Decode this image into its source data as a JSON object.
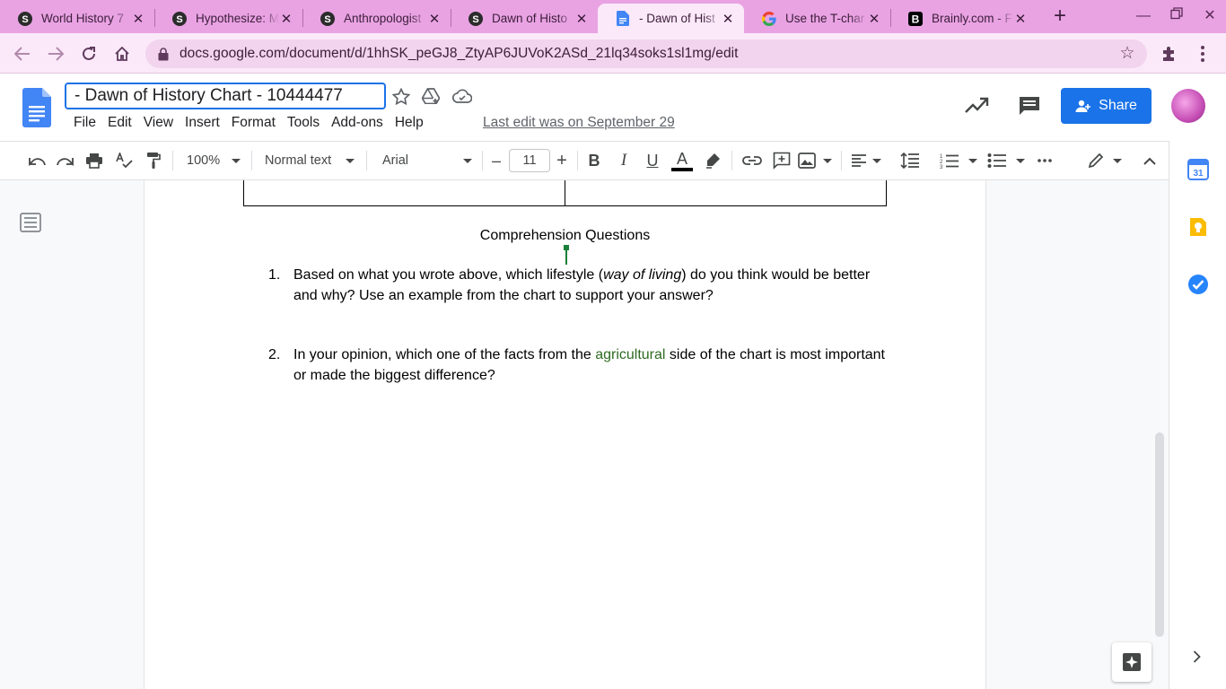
{
  "browser": {
    "tabs": [
      {
        "title": "World History 7",
        "favicon": "schoology-icon"
      },
      {
        "title": "Hypothesize: M",
        "favicon": "schoology-icon"
      },
      {
        "title": "Anthropologist",
        "favicon": "schoology-icon"
      },
      {
        "title": "Dawn of Histo",
        "favicon": "schoology-icon"
      },
      {
        "title": "- Dawn of Hist",
        "favicon": "google-docs-icon",
        "active": true
      },
      {
        "title": "Use the T-char",
        "favicon": "google-icon"
      },
      {
        "title": "Brainly.com - F",
        "favicon": "brainly-icon"
      }
    ],
    "url": "docs.google.com/document/d/1hhSK_peGJ8_ZtyAP6JUVoK2ASd_21lq34soks1sl1mg/edit",
    "theme_color": "#e9a3e3"
  },
  "docs": {
    "title": "- Dawn of History Chart - 10444477",
    "menu": [
      "File",
      "Edit",
      "View",
      "Insert",
      "Format",
      "Tools",
      "Add-ons",
      "Help"
    ],
    "last_edit": "Last edit was on September 29",
    "share_label": "Share",
    "accent_color": "#1a73e8"
  },
  "format_toolbar": {
    "zoom": "100%",
    "style": "Normal text",
    "font": "Arial",
    "font_size": "11",
    "minus": "–",
    "plus": "+"
  },
  "document": {
    "heading": "Comprehension Questions",
    "questions": [
      {
        "num": "1.",
        "part1": "Based on what you wrote above, which lifestyle (",
        "italic": "way of living",
        "part2": ") do you think would be better and why? Use an example from the chart to support your answer?"
      },
      {
        "num": "2.",
        "part1": "In your opinion, which one of the facts from the ",
        "highlight": "agricultural",
        "part2": " side of the chart is most important or made the biggest difference?"
      }
    ]
  },
  "side_panel": {
    "calendar_label": "31"
  }
}
